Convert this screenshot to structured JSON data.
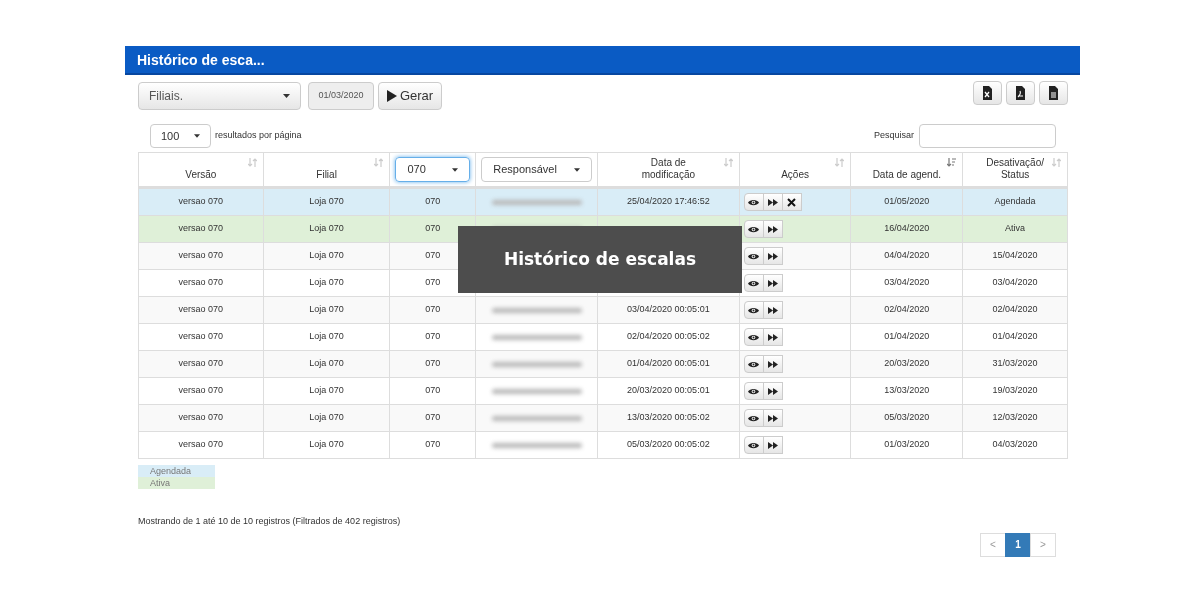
{
  "panel": {
    "title": "Histórico de esca..."
  },
  "filters": {
    "branch_select": "Filiais.",
    "date_field": "01/03/2020",
    "generate_button": "Gerar"
  },
  "export_buttons": [
    {
      "kind": "excel"
    },
    {
      "kind": "pdf"
    },
    {
      "kind": "file"
    }
  ],
  "page_size": {
    "value": "100",
    "label": "resultados por página"
  },
  "search": {
    "label": "Pesquisar"
  },
  "table": {
    "columns": [
      {
        "kind": "sort",
        "label": "Versão",
        "sorted_desc": false
      },
      {
        "kind": "sort",
        "label": "Filial",
        "sorted_desc": false
      },
      {
        "kind": "select",
        "label": "070",
        "focused": true
      },
      {
        "kind": "select",
        "label": "Responsável",
        "focused": false
      },
      {
        "kind": "sort",
        "label": "Data de modificação",
        "sorted_desc": false
      },
      {
        "kind": "sort",
        "label": "Ações",
        "sorted_desc": false
      },
      {
        "kind": "sort",
        "label": "Data de agend.",
        "sorted_desc": true
      },
      {
        "kind": "sort",
        "label": "Desativação/ Status",
        "sorted_desc": false
      }
    ],
    "rows": [
      {
        "color": "#d9edf7",
        "version": "versao 070",
        "branch": "Loja 070",
        "code": "070",
        "modified": "25/04/2020 17:46:52",
        "can_cancel": true,
        "scheduled": "01/05/2020",
        "status": "Agendada"
      },
      {
        "color": "#dff0d8",
        "version": "versao 070",
        "branch": "Loja 070",
        "code": "070",
        "can_cancel": false,
        "scheduled": "16/04/2020",
        "status": "Ativa"
      },
      {
        "version": "versao 070",
        "branch": "Loja 070",
        "code": "070",
        "can_cancel": false,
        "scheduled": "04/04/2020",
        "status": "15/04/2020"
      },
      {
        "version": "versao 070",
        "branch": "Loja 070",
        "code": "070",
        "can_cancel": false,
        "scheduled": "03/04/2020",
        "status": "03/04/2020"
      },
      {
        "version": "versao 070",
        "branch": "Loja 070",
        "code": "070",
        "modified": "03/04/2020 00:05:01",
        "can_cancel": false,
        "scheduled": "02/04/2020",
        "status": "02/04/2020"
      },
      {
        "version": "versao 070",
        "branch": "Loja 070",
        "code": "070",
        "modified": "02/04/2020 00:05:02",
        "can_cancel": false,
        "scheduled": "01/04/2020",
        "status": "01/04/2020"
      },
      {
        "version": "versao 070",
        "branch": "Loja 070",
        "code": "070",
        "modified": "01/04/2020 00:05:01",
        "can_cancel": false,
        "scheduled": "20/03/2020",
        "status": "31/03/2020"
      },
      {
        "version": "versao 070",
        "branch": "Loja 070",
        "code": "070",
        "modified": "20/03/2020 00:05:01",
        "can_cancel": false,
        "scheduled": "13/03/2020",
        "status": "19/03/2020"
      },
      {
        "version": "versao 070",
        "branch": "Loja 070",
        "code": "070",
        "modified": "13/03/2020 00:05:02",
        "can_cancel": false,
        "scheduled": "05/03/2020",
        "status": "12/03/2020"
      },
      {
        "version": "versao 070",
        "branch": "Loja 070",
        "code": "070",
        "modified": "05/03/2020 00:05:02",
        "can_cancel": false,
        "scheduled": "01/03/2020",
        "status": "04/03/2020"
      }
    ]
  },
  "legend": [
    {
      "color": "#d9edf7",
      "label": "Agendada"
    },
    {
      "color": "#dff0d8",
      "label": "Ativa"
    }
  ],
  "summary": "Mostrando de 1 até 10 de 10 registros (Filtrados de 402 registros)",
  "pagination": [
    {
      "label": "<",
      "selected": false
    },
    {
      "label": "1",
      "selected": true
    },
    {
      "label": ">",
      "selected": false
    }
  ],
  "overlay": {
    "title": "Histórico de escalas"
  }
}
